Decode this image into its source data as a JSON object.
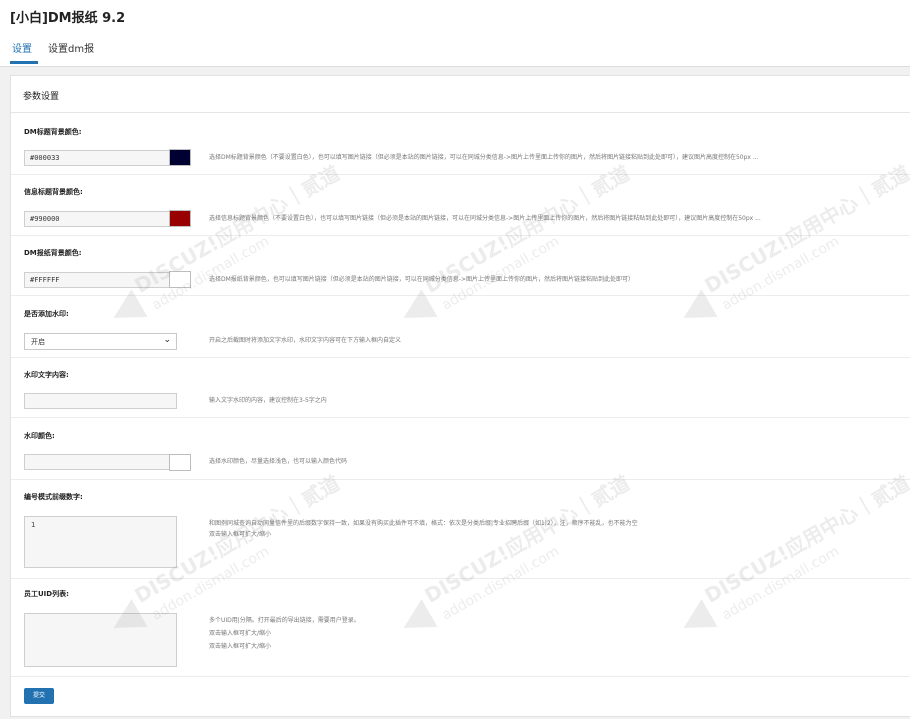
{
  "header": {
    "title": "[小白]DM报纸 9.2"
  },
  "tabs": [
    {
      "label": "设置",
      "active": true
    },
    {
      "label": "设置dm报",
      "active": false
    }
  ],
  "panel": {
    "title": "参数设置"
  },
  "fields": {
    "dm_title_bg": {
      "label": "DM标题背景颜色:",
      "value": "#000033",
      "swatch": "#000033",
      "desc": "选择DM标题背景颜色（不要设置白色），也可以填写图片链接（但必须是本站的图片链接，可以在同城分类信息->图片上传里面上传你的图片，然后将图片链接粘贴到此处即可），建议图片高度控制在50px ..."
    },
    "info_title_bg": {
      "label": "信息标题背景颜色:",
      "value": "#990000",
      "swatch": "#990000",
      "desc": "选择信息标题背景颜色（不要设置白色），也可以填写图片链接（但必须是本站的图片链接，可以在同城分类信息->图片上传里面上传你的图片，然后将图片链接粘贴到此处即可），建议图片高度控制在50px ..."
    },
    "dm_paper_bg": {
      "label": "DM报纸背景颜色:",
      "value": "#FFFFFF",
      "swatch": "#FFFFFF",
      "desc": "选择DM报纸背景颜色，也可以填写图片链接（但必须是本站的图片链接，可以在同城分类信息->图片上传里面上传你的图片，然后将图片链接粘贴到此处即可）"
    },
    "add_watermark": {
      "label": "是否添加水印:",
      "selected": "开启",
      "desc": "开启之后截图时将添加文字水印，水印文字内容可在下方输入框内自定义"
    },
    "watermark_text": {
      "label": "水印文字内容:",
      "value": "",
      "desc": "输入文字水印的内容，建议控制在3-5字之内"
    },
    "watermark_color": {
      "label": "水印颜色:",
      "value": "",
      "swatch": "#FFFFFF",
      "desc": "选择水印颜色，尽量选择浅色，也可以输入颜色代码"
    },
    "number_mode": {
      "label": "编号模式前缀数字:",
      "value": "1",
      "desc_lines": [
        "和图例同城查询自动同量信件里的后缀数字保持一致，如果没有购买此插件可不填，格式：依次是分类后缀|专业招聘后缀（如1|2），注，顺序不能乱，也不能为空",
        "双击输入框可扩大/缩小"
      ]
    },
    "staff_uid": {
      "label": "员工UID列表:",
      "value": "",
      "desc_lines": [
        "多个UID用|分隔。打开最后的导出链接，需要用户登录。",
        "双击输入框可扩大/缩小",
        "双击输入框可扩大/缩小"
      ]
    }
  },
  "submit_label": "提交",
  "watermark": {
    "line1": "DISCUZ!应用中心｜贰道",
    "line2": "addon.dismall.com"
  }
}
